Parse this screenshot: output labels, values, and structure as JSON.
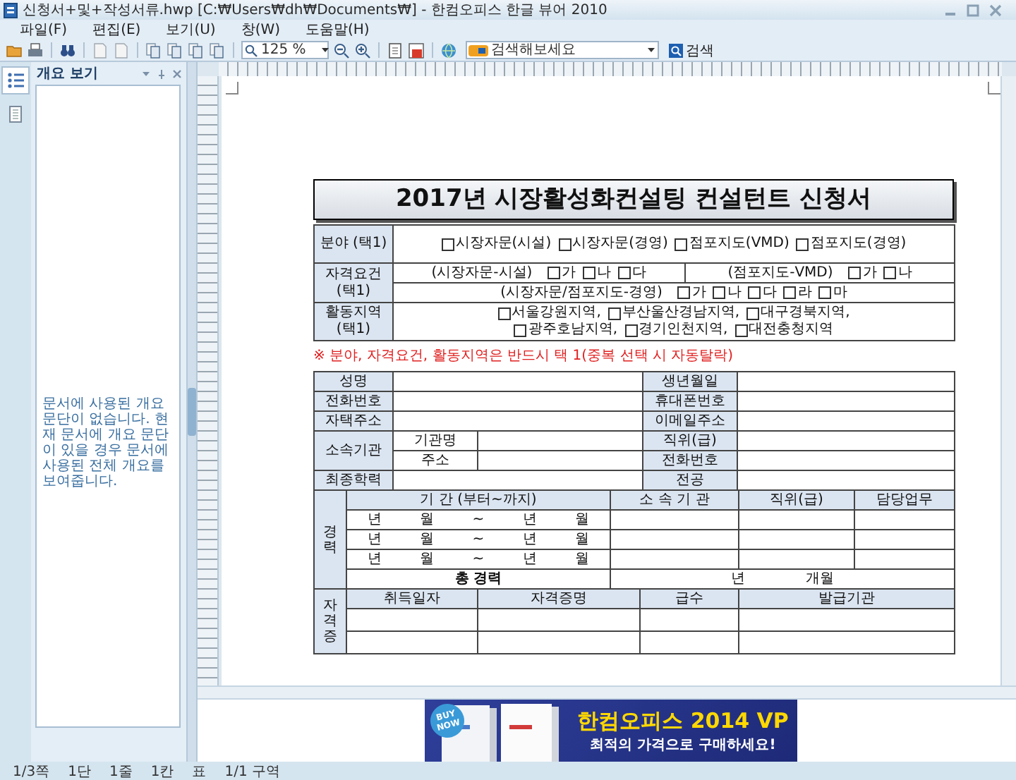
{
  "window": {
    "title": "신청서+및+작성서류.hwp [C:₩Users₩dh₩Documents₩] - 한컴오피스 한글 뷰어 2010"
  },
  "menu": [
    {
      "label": "파일(F)"
    },
    {
      "label": "편집(E)"
    },
    {
      "label": "보기(U)"
    },
    {
      "label": "창(W)"
    },
    {
      "label": "도움말(H)"
    }
  ],
  "toolbar": {
    "zoom": "125 %",
    "search_placeholder": "검색해보세요",
    "search_button": "검색"
  },
  "side_tabs": [
    {
      "kind": "outline",
      "selected": true
    },
    {
      "kind": "pages",
      "selected": false
    }
  ],
  "outline_panel": {
    "title": "개요 보기",
    "message": "문서에 사용된 개요 문단이 없습니다. 현재 문서에 개요 문단이 있을 경우 문서에 사용된 전체 개요를 보여줍니다."
  },
  "document": {
    "title": "2017년 시장활성화컨설팅 컨설턴트 신청서",
    "field_choice": {
      "label": "분야 (택1)",
      "options": [
        {
          "text": "시장자문(시설)",
          "checked": false
        },
        {
          "text": "시장자문(경영)",
          "checked": false
        },
        {
          "text": "점포지도(VMD)",
          "checked": false
        },
        {
          "text": "점포지도(경영)",
          "checked": false
        }
      ]
    },
    "qualification": {
      "label": "자격요건 (택1)",
      "groups": [
        {
          "name": "(시장자문-시설)",
          "options": [
            {
              "text": "가",
              "checked": false
            },
            {
              "text": "나",
              "checked": false
            },
            {
              "text": "다",
              "checked": false
            }
          ]
        },
        {
          "name": "(점포지도-VMD)",
          "options": [
            {
              "text": "가",
              "checked": false
            },
            {
              "text": "나",
              "checked": false
            }
          ]
        },
        {
          "name": "(시장자문/점포지도-경영)",
          "options": [
            {
              "text": "가",
              "checked": false
            },
            {
              "text": "나",
              "checked": false
            },
            {
              "text": "다",
              "checked": false
            },
            {
              "text": "라",
              "checked": false
            },
            {
              "text": "마",
              "checked": false
            }
          ]
        }
      ]
    },
    "region": {
      "label": "활동지역 (택1)",
      "lines": [
        [
          {
            "text": "서울강원지역,",
            "checked": false
          },
          {
            "text": "부산울산경남지역,",
            "checked": false
          },
          {
            "text": "대구경북지역,",
            "checked": false
          }
        ],
        [
          {
            "text": "광주호남지역,",
            "checked": false
          },
          {
            "text": "경기인천지역,",
            "checked": false
          },
          {
            "text": "대전충청지역",
            "checked": false
          }
        ]
      ]
    },
    "notice": "※ 분야, 자격요건, 활동지역은 반드시 택 1(중복 선택 시 자동탈락)",
    "personal": [
      {
        "kind": "pair",
        "left": "성명",
        "right": "생년월일"
      },
      {
        "kind": "pair",
        "left": "전화번호",
        "right": "휴대폰번호"
      },
      {
        "kind": "pair",
        "left": "자택주소",
        "right": "이메일주소"
      },
      {
        "kind": "group",
        "left": "소속기관",
        "subs": [
          {
            "sub": "기관명",
            "right": "직위(급)"
          },
          {
            "sub": "주소",
            "right": "전화번호"
          }
        ]
      },
      {
        "kind": "pair",
        "left": "최종학력",
        "right": "전공"
      }
    ],
    "career": {
      "label": "경력",
      "columns": [
        "기 간 (부터~까지)",
        "소 속 기 관",
        "직위(급)",
        "담당업무"
      ],
      "rows": [
        {
          "period": "년 월 ~ 년 월"
        },
        {
          "period": "년 월 ~ 년 월"
        },
        {
          "period": "년 월 ~ 년 월"
        }
      ],
      "total_label": "총 경력",
      "total_value": "년 개월"
    },
    "certificates": {
      "label": "자격증",
      "columns": [
        "취득일자",
        "자격증명",
        "급수",
        "발급기관"
      ]
    }
  },
  "ad": {
    "badge": "BUY NOW",
    "headline": "한컴오피스 2014 VP",
    "tagline": "최적의 가격으로 구매하세요!"
  },
  "status_bar": [
    {
      "text": "1/3쪽"
    },
    {
      "text": "1단"
    },
    {
      "text": "1줄"
    },
    {
      "text": "1칸"
    },
    {
      "text": "표"
    },
    {
      "text": "1/1 구역"
    }
  ]
}
